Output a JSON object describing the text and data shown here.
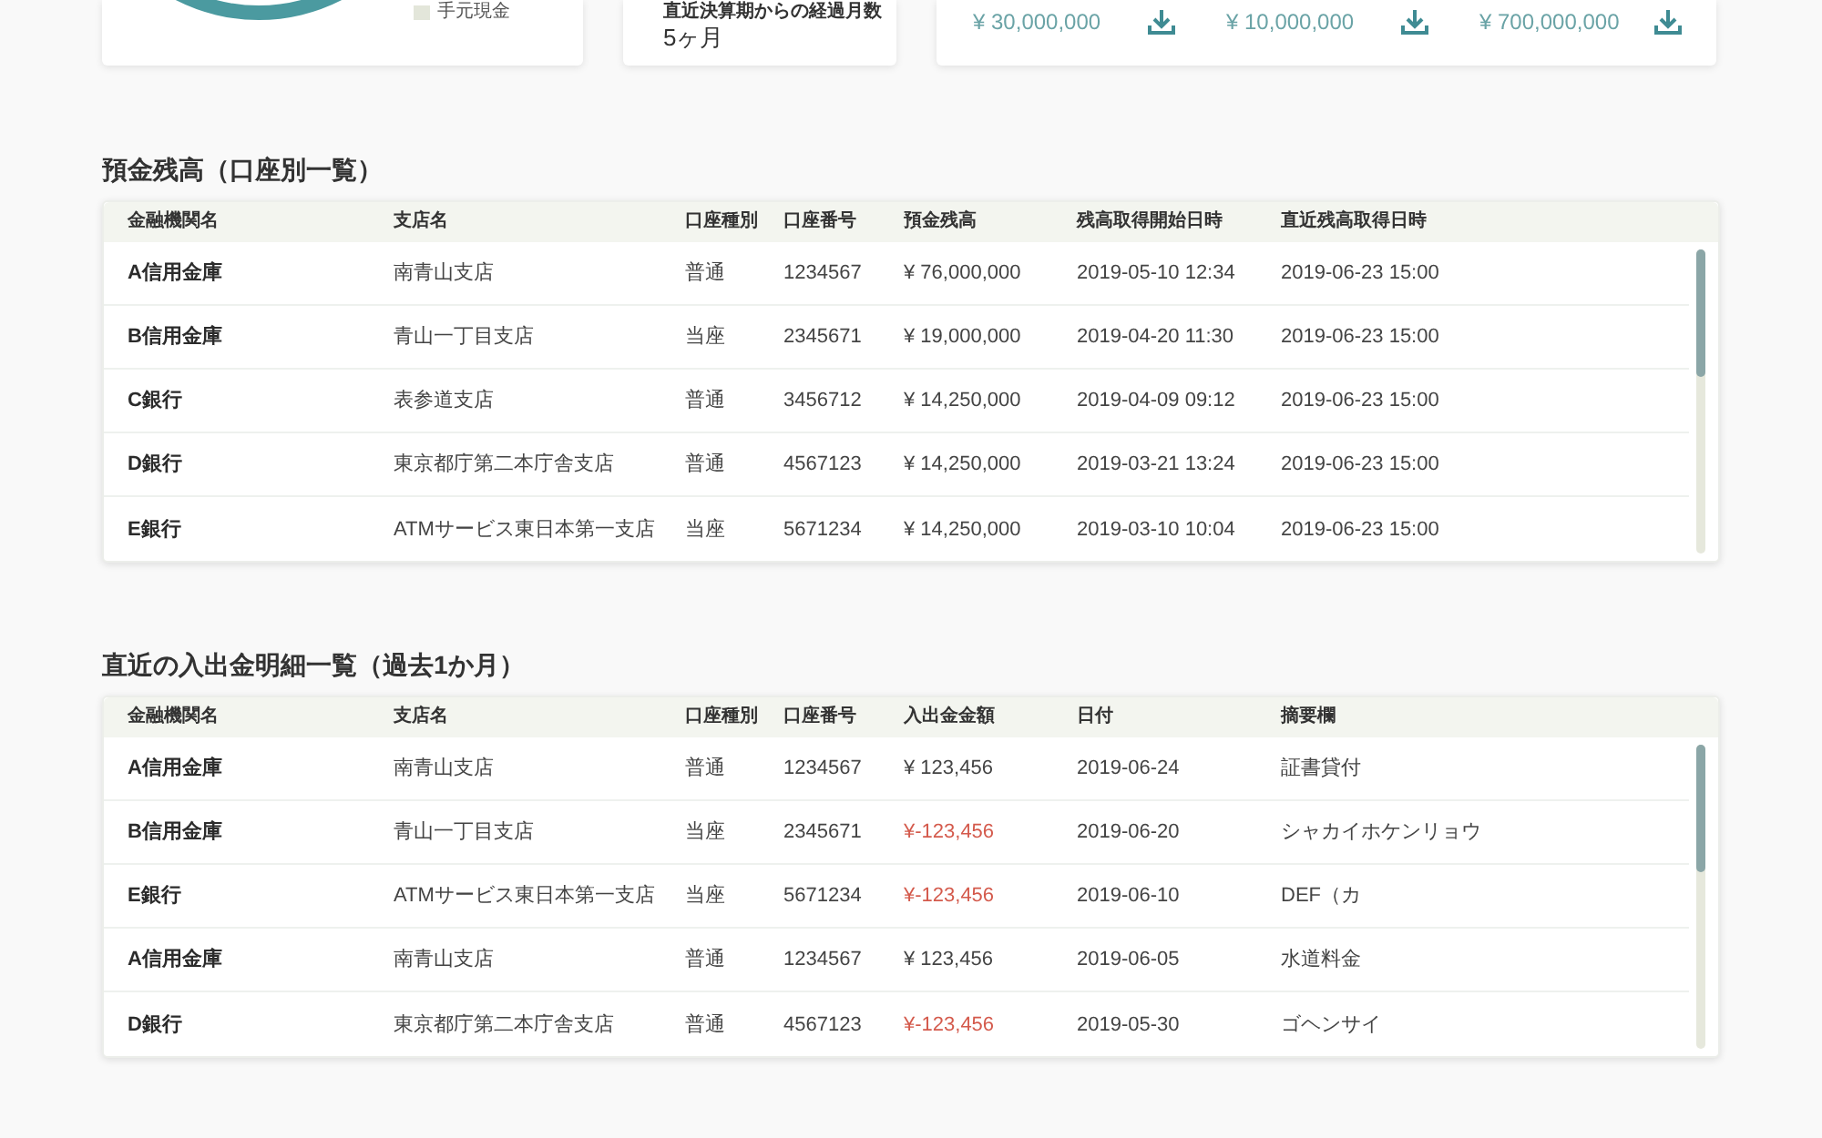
{
  "summary_cards": {
    "cash_legend": "手元現金",
    "months_card": {
      "label": "直近決算期からの経過月数",
      "value": "5ヶ月"
    },
    "amounts": [
      "¥ 30,000,000",
      "¥ 10,000,000",
      "¥ 700,000,000"
    ]
  },
  "balances": {
    "title": "預金残高（口座別一覧）",
    "columns": [
      "金融機関名",
      "支店名",
      "口座種別",
      "口座番号",
      "預金残高",
      "残高取得開始日時",
      "直近残高取得日時"
    ],
    "rows": [
      [
        "A信用金庫",
        "南青山支店",
        "普通",
        "1234567",
        "¥ 76,000,000",
        "2019-05-10 12:34",
        "2019-06-23 15:00"
      ],
      [
        "B信用金庫",
        "青山一丁目支店",
        "当座",
        "2345671",
        "¥ 19,000,000",
        "2019-04-20 11:30",
        "2019-06-23 15:00"
      ],
      [
        "C銀行",
        "表参道支店",
        "普通",
        "3456712",
        "¥ 14,250,000",
        "2019-04-09 09:12",
        "2019-06-23 15:00"
      ],
      [
        "D銀行",
        "東京都庁第二本庁舎支店",
        "普通",
        "4567123",
        "¥ 14,250,000",
        "2019-03-21 13:24",
        "2019-06-23 15:00"
      ],
      [
        "E銀行",
        "ATMサービス東日本第一支店",
        "当座",
        "5671234",
        "¥ 14,250,000",
        "2019-03-10 10:04",
        "2019-06-23 15:00"
      ]
    ]
  },
  "transactions": {
    "title": "直近の入出金明細一覧（過去1か月）",
    "columns": [
      "金融機関名",
      "支店名",
      "口座種別",
      "口座番号",
      "入出金金額",
      "日付",
      "摘要欄"
    ],
    "rows": [
      {
        "cells": [
          "A信用金庫",
          "南青山支店",
          "普通",
          "1234567",
          "¥ 123,456",
          "2019-06-24",
          "証書貸付"
        ],
        "negative": false
      },
      {
        "cells": [
          "B信用金庫",
          "青山一丁目支店",
          "当座",
          "2345671",
          "¥-123,456",
          "2019-06-20",
          "シャカイホケンリョウ"
        ],
        "negative": true
      },
      {
        "cells": [
          "E銀行",
          "ATMサービス東日本第一支店",
          "当座",
          "5671234",
          "¥-123,456",
          "2019-06-10",
          "DEF（カ"
        ],
        "negative": true
      },
      {
        "cells": [
          "A信用金庫",
          "南青山支店",
          "普通",
          "1234567",
          "¥ 123,456",
          "2019-06-05",
          "水道料金"
        ],
        "negative": false
      },
      {
        "cells": [
          "D銀行",
          "東京都庁第二本庁舎支店",
          "普通",
          "4567123",
          "¥-123,456",
          "2019-05-30",
          "ゴヘンサイ"
        ],
        "negative": true
      }
    ]
  }
}
